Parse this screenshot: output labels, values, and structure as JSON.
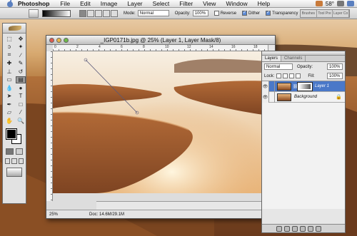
{
  "menubar": {
    "app_name": "Photoshop",
    "items": [
      "File",
      "Edit",
      "Image",
      "Layer",
      "Select",
      "Filter",
      "View",
      "Window",
      "Help"
    ],
    "temperature": "58°"
  },
  "options": {
    "mode_label": "Mode:",
    "mode_value": "Normal",
    "opacity_label": "Opacity:",
    "opacity_value": "100%",
    "reverse_label": "Reverse",
    "dither_label": "Dither",
    "transparency_label": "Transparency",
    "reverse_checked": false,
    "dither_checked": true,
    "transparency_checked": true,
    "palette_well_tabs": [
      "Brushes",
      "Tool Pre",
      "Layer Co"
    ]
  },
  "document": {
    "title": "_IGP0171b.jpg @ 25% (Layer 1, Layer Mask/8)",
    "zoom": "25%",
    "doc_size": "Doc: 14.6M/29.1M",
    "ruler_marks": [
      "0",
      "2",
      "4",
      "6",
      "8",
      "10",
      "12",
      "14",
      "16",
      "18"
    ]
  },
  "layers_palette": {
    "tabs": [
      "Layers",
      "Channels"
    ],
    "blend_mode": "Normal",
    "opacity_label": "Opacity:",
    "opacity_value": "100%",
    "lock_label": "Lock:",
    "fill_label": "Fill:",
    "fill_value": "100%",
    "layers": [
      {
        "name": "Layer 1",
        "selected": true,
        "has_mask": true
      },
      {
        "name": "Background",
        "selected": false,
        "locked": true
      }
    ]
  },
  "colors": {
    "accent": "#4a78c8",
    "foreground": "#000000",
    "background": "#ffffff"
  }
}
